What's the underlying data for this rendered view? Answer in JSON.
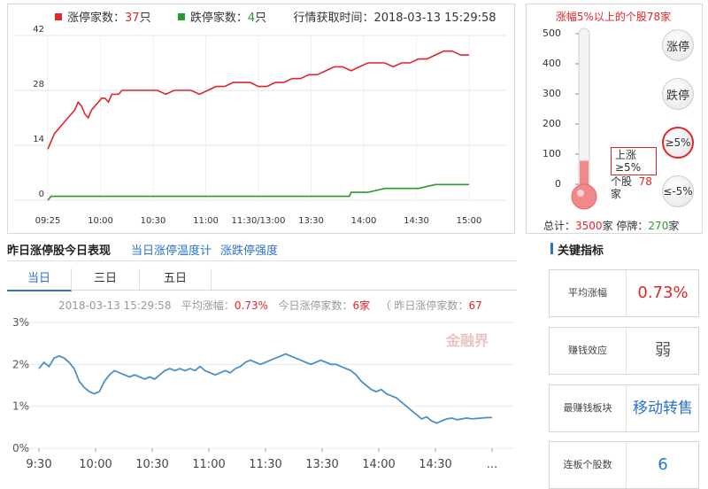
{
  "top_legend": {
    "limit_up_label": "涨停家数：",
    "limit_up_count": "37",
    "limit_up_unit": "只",
    "limit_down_label": "跌停家数：",
    "limit_down_count": "4",
    "limit_down_unit": "只",
    "fetch_time_label": "行情获取时间：",
    "fetch_time": "2018-03-13 15:29:58"
  },
  "thermometer": {
    "title": "涨幅5%以上的个股78家",
    "ticks": [
      "500",
      "400",
      "300",
      "200",
      "100",
      "0"
    ],
    "value": 78,
    "max": 500,
    "tip_lines": [
      "上涨",
      "≥5%",
      "个股"
    ],
    "tip_value": "78",
    "buttons": [
      "涨停",
      "跌停",
      "≥5%",
      "≤-5%"
    ],
    "total_label": "总计：",
    "total_value": "3500",
    "total_unit": "家",
    "halt_label": "停牌：",
    "halt_value": "270",
    "halt_unit": "家"
  },
  "section": {
    "title": "昨日涨停股今日表现",
    "link1": "当日涨停温度计",
    "link2": "涨跌停强度",
    "tabs": [
      "当日",
      "三日",
      "五日"
    ]
  },
  "info_bar": {
    "time": "2018-03-13 15:29:58",
    "avg_label": "平均涨幅：",
    "avg_value": "0.73%",
    "today_label": "今日涨停家数：",
    "today_value": "6家",
    "yest_label": "（ 昨日涨停家数：",
    "yest_value": "67"
  },
  "key_metrics": {
    "title": "关键指标",
    "cards": [
      {
        "label": "平均涨幅",
        "value": "0.73%"
      },
      {
        "label": "赚钱效应",
        "value": "弱"
      },
      {
        "label": "最赚钱板块",
        "value": "移动转售"
      },
      {
        "label": "连板个股数",
        "value": "6"
      }
    ]
  },
  "watermark": "金融界",
  "colors": {
    "red": "#e0262a",
    "green": "#2a9a2a",
    "blue_line": "#4a90c8",
    "link": "#2b73c9"
  },
  "chart_data": [
    {
      "type": "line",
      "x_tick_labels": [
        "09:25",
        "10:00",
        "10:30",
        "11:00",
        "11:30/13:00",
        "13:30",
        "14:00",
        "14:30",
        "15:00"
      ],
      "y_tick_labels": [
        "0",
        "14",
        "28",
        "42"
      ],
      "ylim": [
        0,
        42
      ],
      "series": [
        {
          "color": "#e0262a",
          "x": [
            0,
            2,
            4,
            6,
            8,
            10,
            12,
            14,
            16,
            18,
            20,
            22,
            24,
            26,
            28,
            30,
            32,
            34,
            36,
            38,
            40,
            42,
            44,
            46,
            48,
            50,
            55,
            60,
            65,
            70,
            75,
            80,
            85,
            90,
            95,
            100,
            105,
            110,
            115,
            120,
            125,
            130,
            135,
            140,
            145,
            150,
            155,
            160,
            165,
            170,
            175,
            180,
            185,
            190,
            195,
            200,
            205,
            210,
            215,
            220,
            225,
            230,
            235,
            240,
            245,
            250
          ],
          "y": [
            13,
            15,
            17,
            18,
            19,
            20,
            21,
            22,
            23,
            25,
            24,
            22,
            21,
            23,
            24,
            25,
            26,
            26,
            25,
            27,
            27,
            27,
            28,
            28,
            28,
            28,
            28,
            28,
            28,
            27,
            28,
            28,
            28,
            27,
            28,
            29,
            29,
            30,
            30,
            30,
            29,
            29,
            30,
            30,
            31,
            31,
            32,
            32,
            33,
            34,
            34,
            33,
            34,
            35,
            35,
            35,
            34,
            35,
            35,
            36,
            36,
            37,
            38,
            38,
            37,
            37
          ]
        },
        {
          "color": "#2a9a2a",
          "x": [
            0,
            2,
            4,
            60,
            120,
            160,
            179,
            180,
            190,
            200,
            210,
            220,
            230,
            240,
            250
          ],
          "y": [
            0,
            1,
            1,
            1,
            1,
            1,
            1,
            2,
            2,
            3,
            3,
            3,
            4,
            4,
            4
          ]
        }
      ]
    },
    {
      "type": "line",
      "x_tick_labels": [
        "9:30",
        "10:00",
        "10:30",
        "11:00",
        "11:30",
        "13:30",
        "14:00",
        "14:30",
        "..."
      ],
      "y_tick_labels": [
        "0%",
        "1%",
        "2%",
        "3%"
      ],
      "ylim": [
        0,
        3
      ],
      "series": [
        {
          "color": "#4a90c8",
          "x": [
            0,
            3,
            6,
            9,
            12,
            15,
            18,
            21,
            24,
            27,
            30,
            33,
            36,
            39,
            42,
            45,
            48,
            51,
            54,
            57,
            60,
            63,
            66,
            69,
            72,
            75,
            78,
            81,
            84,
            87,
            90,
            93,
            96,
            99,
            102,
            105,
            108,
            111,
            114,
            117,
            120,
            123,
            126,
            129,
            132,
            135,
            138,
            141,
            144,
            147,
            150,
            153,
            156,
            159,
            162,
            165,
            168,
            171,
            174,
            177,
            180,
            183,
            186,
            189,
            192,
            195,
            198,
            201,
            204,
            207,
            210,
            213,
            216,
            219,
            222,
            225,
            228,
            231,
            234,
            237,
            240,
            243,
            246,
            249,
            252,
            255,
            258,
            261,
            264,
            267,
            270
          ],
          "y": [
            1.9,
            2.05,
            1.95,
            2.15,
            2.2,
            2.15,
            2.05,
            1.9,
            1.6,
            1.45,
            1.35,
            1.3,
            1.35,
            1.6,
            1.75,
            1.85,
            1.8,
            1.75,
            1.7,
            1.75,
            1.7,
            1.65,
            1.7,
            1.65,
            1.75,
            1.85,
            1.9,
            1.85,
            1.9,
            1.85,
            1.9,
            1.85,
            1.95,
            1.85,
            1.8,
            1.75,
            1.8,
            1.85,
            1.8,
            1.9,
            1.95,
            2.05,
            2.1,
            2.05,
            2.0,
            2.05,
            2.1,
            2.15,
            2.2,
            2.25,
            2.2,
            2.15,
            2.1,
            2.05,
            2.0,
            2.05,
            2.1,
            2.05,
            2.0,
            2.0,
            1.95,
            1.9,
            1.85,
            1.75,
            1.6,
            1.5,
            1.4,
            1.35,
            1.4,
            1.3,
            1.25,
            1.2,
            1.1,
            1.0,
            0.9,
            0.8,
            0.7,
            0.75,
            0.65,
            0.6,
            0.65,
            0.7,
            0.72,
            0.68,
            0.7,
            0.72,
            0.7,
            0.71,
            0.72,
            0.73,
            0.73
          ]
        }
      ]
    }
  ]
}
